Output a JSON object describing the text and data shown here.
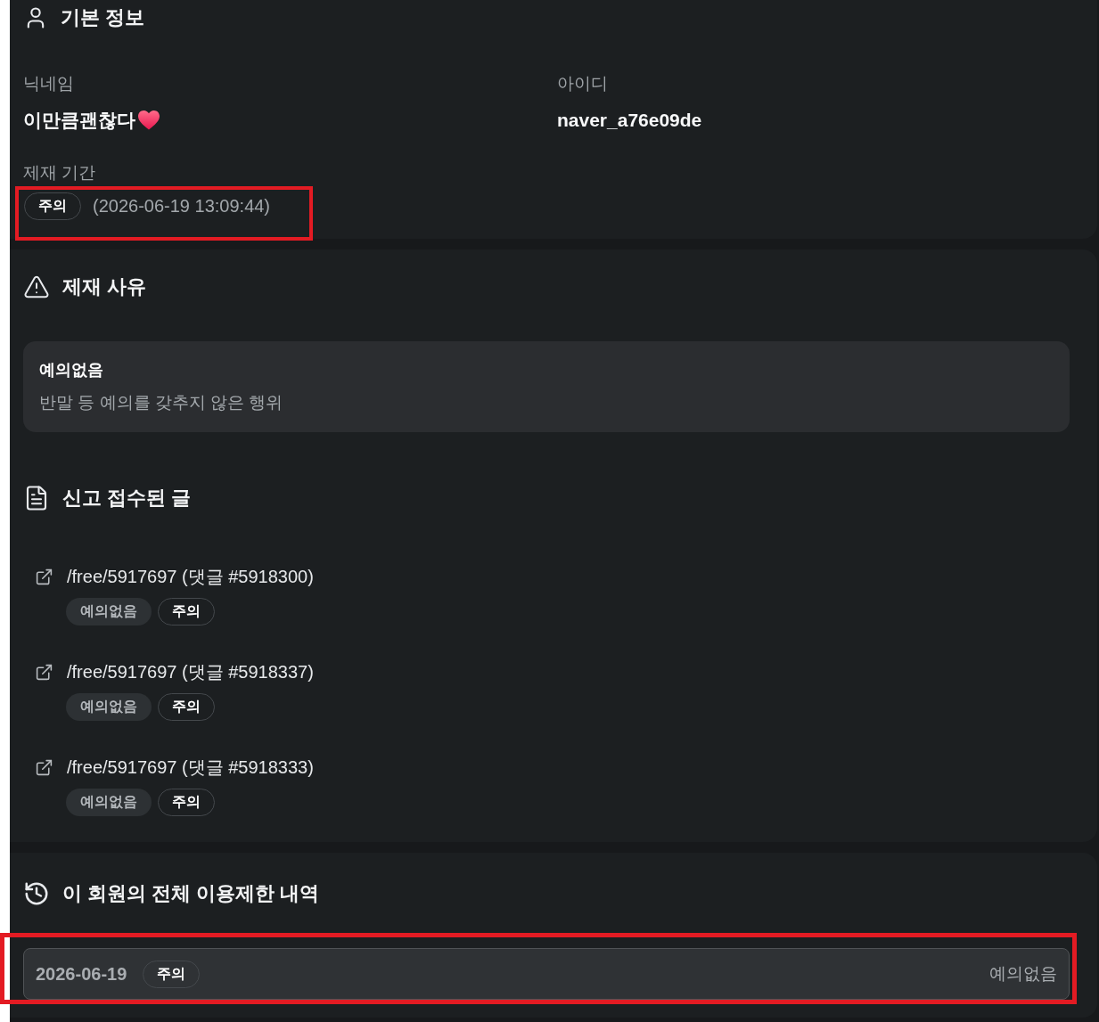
{
  "basic_info": {
    "title": "기본 정보",
    "fields": [
      {
        "label": "닉네임",
        "value": "이만큼괜찮다"
      },
      {
        "label": "아이디",
        "value": "naver_a76e09de"
      }
    ],
    "period": {
      "label": "제재 기간",
      "badge": "주의",
      "value": "(2026-06-19 13:09:44)",
      "highlighted": true
    }
  },
  "reason": {
    "title": "제재 사유",
    "name": "예의없음",
    "description": "반말 등 예의를 갖추지 않은 행위"
  },
  "reports": {
    "title": "신고 접수된 글",
    "items": [
      {
        "link": "/free/5917697 (댓글 #5918300)",
        "tags": [
          {
            "label": "예의없음",
            "kind": "reason"
          },
          {
            "label": "주의",
            "kind": "level"
          }
        ]
      },
      {
        "link": "/free/5917697 (댓글 #5918337)",
        "tags": [
          {
            "label": "예의없음",
            "kind": "reason"
          },
          {
            "label": "주의",
            "kind": "level"
          }
        ]
      },
      {
        "link": "/free/5917697 (댓글 #5918333)",
        "tags": [
          {
            "label": "예의없음",
            "kind": "reason"
          },
          {
            "label": "주의",
            "kind": "level"
          }
        ]
      }
    ]
  },
  "history": {
    "title": "이 회원의 전체 이용제한 내역",
    "entries": [
      {
        "date": "2026-06-19",
        "badge": "주의",
        "reason": "예의없음",
        "highlighted": true
      }
    ]
  }
}
